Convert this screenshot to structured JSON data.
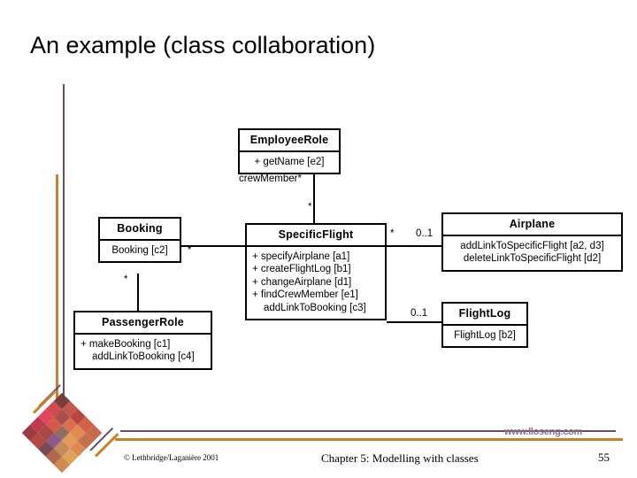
{
  "slide": {
    "title": "An example (class collaboration)",
    "site_url": "www.lloseng.com"
  },
  "footer": {
    "copyright": "© Lethbridge/Laganière 2001",
    "chapter": "Chapter 5: Modelling with classes",
    "page_number": "55"
  },
  "colors": {
    "rail_purple": "#6b4a63",
    "rail_orange": "#c8802d",
    "url_purple": "#8a7490",
    "box_border": "#000000",
    "background": "#ffffff"
  },
  "diagram": {
    "classes": [
      {
        "id": "employee-role",
        "name": "EmployeeRole",
        "operations": [
          "+ getName [e2]"
        ]
      },
      {
        "id": "booking",
        "name": "Booking",
        "operations": [
          "Booking [c2]"
        ]
      },
      {
        "id": "specific-flight",
        "name": "SpecificFlight",
        "operations": [
          "+ specifyAirplane [a1]",
          "+ createFlightLog [b1]",
          "+ changeAirplane [d1]",
          "+ findCrewMember [e1]",
          "addLinkToBooking [c3]"
        ]
      },
      {
        "id": "airplane",
        "name": "Airplane",
        "operations": [
          "addLinkToSpecificFlight [a2, d3]",
          "deleteLinkToSpecificFlight [d2]"
        ]
      },
      {
        "id": "flight-log",
        "name": "FlightLog",
        "operations": [
          "FlightLog [b2]"
        ]
      },
      {
        "id": "passenger-role",
        "name": "PassengerRole",
        "operations": [
          "+ makeBooking [c1]",
          "addLinkToBooking [c4]"
        ]
      }
    ],
    "association_labels": {
      "crew_member_role": "crewMember*",
      "employee_to_flight_mult": "*",
      "booking_to_flight_mult": "*",
      "booking_to_passenger_mult": "*",
      "flight_to_airplane_mult": "*",
      "airplane_mult": "0..1",
      "flight_log_mult": "0..1"
    }
  },
  "quilt_colors": [
    "#7a3c3a",
    "#c4574f",
    "#b8453f",
    "#d4604a",
    "#c96a4e",
    "#d14a52",
    "#a8504a",
    "#d9704f",
    "#e08a55",
    "#c2724a",
    "#e0465e",
    "#d65a4a",
    "#8d6e60",
    "#e59a5c",
    "#d98a52",
    "#c03a4e",
    "#a84a44",
    "#8a5a8a",
    "#c78a5a",
    "#e0a060",
    "#9e3a46",
    "#b04a42",
    "#7a4a52",
    "#b06a4a",
    "#d08a50"
  ]
}
